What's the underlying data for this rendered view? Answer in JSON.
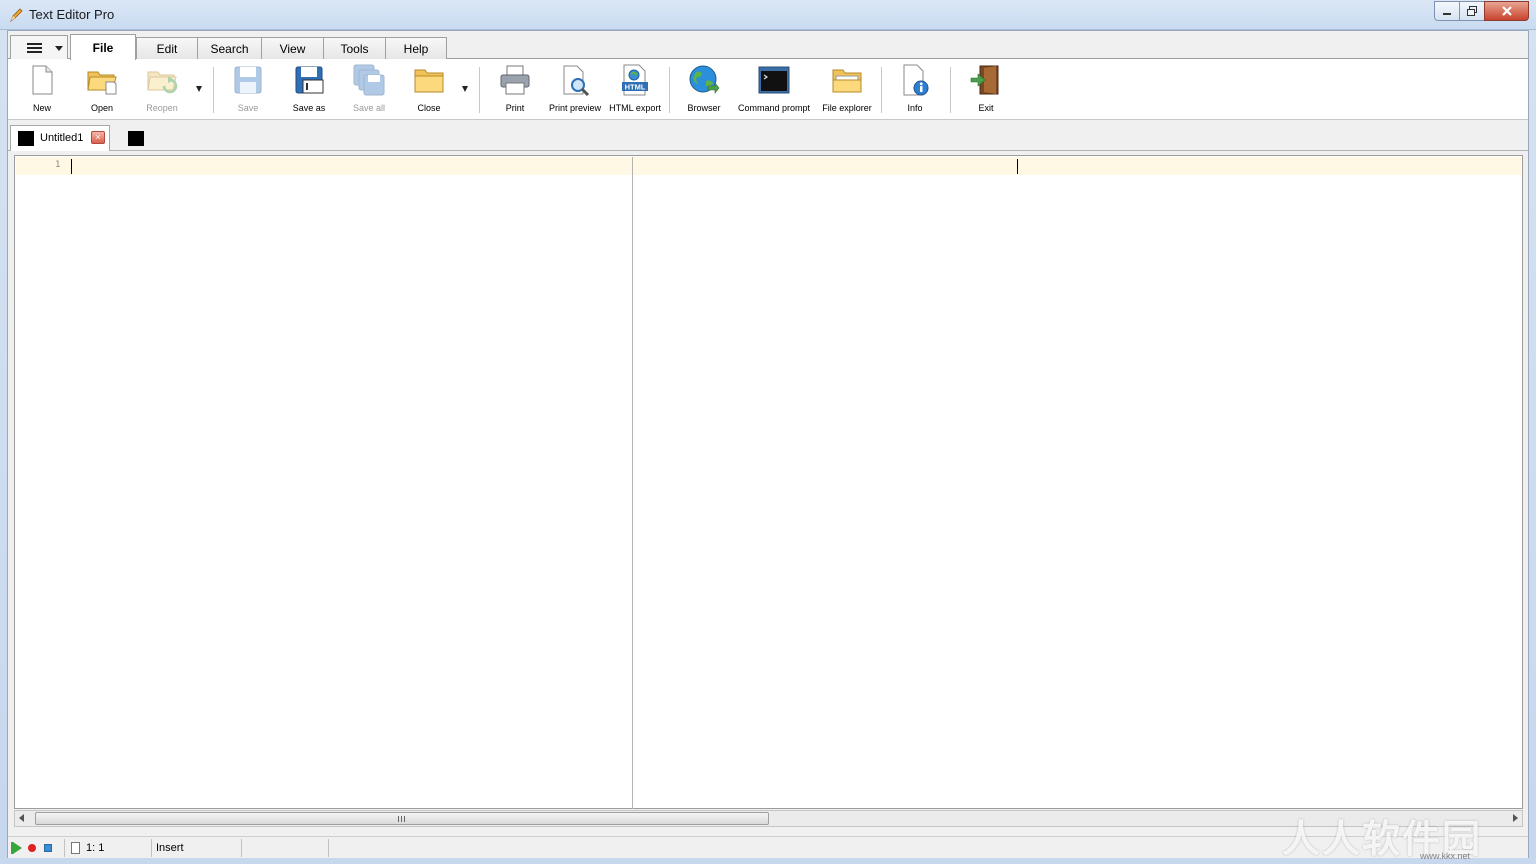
{
  "window": {
    "title": "Text Editor Pro"
  },
  "ribbon_tabs": [
    {
      "label": "File",
      "active": true
    },
    {
      "label": "Edit"
    },
    {
      "label": "Search"
    },
    {
      "label": "View"
    },
    {
      "label": "Tools"
    },
    {
      "label": "Help"
    }
  ],
  "toolbar": {
    "new": "New",
    "open": "Open",
    "reopen": "Reopen",
    "save": "Save",
    "save_as": "Save as",
    "save_all": "Save all",
    "close": "Close",
    "print": "Print",
    "print_preview": "Print preview",
    "html_export": "HTML export",
    "browser": "Browser",
    "command_prompt": "Command prompt",
    "file_explorer": "File explorer",
    "info": "Info",
    "exit": "Exit",
    "html_badge": "HTML"
  },
  "document_tabs": [
    {
      "name": "Untitled1",
      "close": "×"
    }
  ],
  "editor": {
    "line_numbers": [
      "1"
    ]
  },
  "statusbar": {
    "position": "1: 1",
    "mode": "Insert"
  },
  "watermark": {
    "text": "人人软件园",
    "small": "www.kkx.net"
  },
  "colors": {
    "current_line": "#fff8e5",
    "accent_close": "#c8432d"
  }
}
